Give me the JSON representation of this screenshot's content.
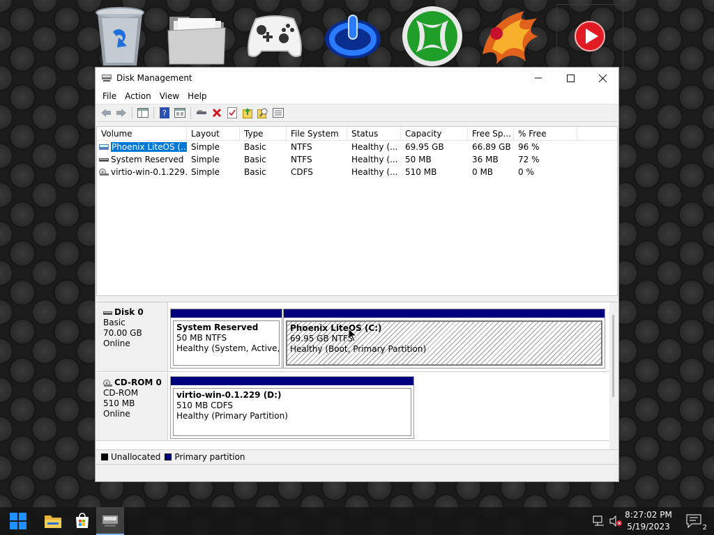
{
  "window": {
    "title": "Disk Management",
    "menu": [
      "File",
      "Action",
      "View",
      "Help"
    ]
  },
  "columns": [
    "Volume",
    "Layout",
    "Type",
    "File System",
    "Status",
    "Capacity",
    "Free Sp...",
    "% Free"
  ],
  "volumes": [
    {
      "name": "Phoenix LiteOS (...",
      "layout": "Simple",
      "type": "Basic",
      "fs": "NTFS",
      "status": "Healthy (...",
      "capacity": "69.95 GB",
      "free": "66.89 GB",
      "pct": "96 %"
    },
    {
      "name": "System Reserved",
      "layout": "Simple",
      "type": "Basic",
      "fs": "NTFS",
      "status": "Healthy (...",
      "capacity": "50 MB",
      "free": "36 MB",
      "pct": "72 %"
    },
    {
      "name": "virtio-win-0.1.229...",
      "layout": "Simple",
      "type": "Basic",
      "fs": "CDFS",
      "status": "Healthy (...",
      "capacity": "510 MB",
      "free": "0 MB",
      "pct": "0 %"
    }
  ],
  "disks": [
    {
      "name": "Disk 0",
      "kind": "Basic",
      "size": "70.00 GB",
      "state": "Online",
      "partitions": [
        {
          "name": "System Reserved",
          "detail": "50 MB NTFS",
          "status": "Healthy (System, Active, Pri"
        },
        {
          "name": "Phoenix LiteOS  (C:)",
          "detail": "69.95 GB NTFS",
          "status": "Healthy (Boot, Primary Partition)"
        }
      ]
    },
    {
      "name": "CD-ROM 0",
      "kind": "CD-ROM",
      "size": "510 MB",
      "state": "Online",
      "partitions": [
        {
          "name": "virtio-win-0.1.229  (D:)",
          "detail": "510 MB CDFS",
          "status": "Healthy (Primary Partition)"
        }
      ]
    }
  ],
  "legend": [
    {
      "label": "Unallocated",
      "color": "#000000"
    },
    {
      "label": "Primary partition",
      "color": "#00007f"
    }
  ],
  "clock": {
    "time": "8:27:02 PM",
    "date": "5/19/2023"
  },
  "notifications": {
    "count": "2"
  },
  "colors": {
    "selection": "#0078d7",
    "partition_bar": "#00007f"
  },
  "icons": {
    "desktop": [
      "recycle-bin-icon",
      "folder-icon",
      "gamepad-icon",
      "power-icon",
      "xbox-icon",
      "phoenix-icon",
      "play-icon"
    ],
    "toolbar": [
      "back-icon",
      "forward-icon",
      "console-tree-icon",
      "help-icon",
      "properties-icon",
      "connect-icon",
      "delete-icon",
      "check-icon",
      "import-icon",
      "search-icon",
      "list-icon"
    ],
    "taskbar": [
      "start-icon",
      "file-explorer-icon",
      "store-icon",
      "disk-management-icon"
    ],
    "tray": [
      "network-icon",
      "volume-muted-icon"
    ]
  }
}
